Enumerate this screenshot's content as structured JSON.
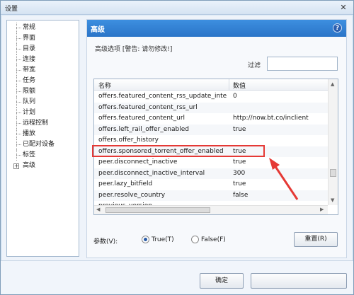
{
  "window": {
    "title": "设置",
    "close_glyph": "✕"
  },
  "nav": {
    "items": [
      {
        "label": "常规"
      },
      {
        "label": "界面"
      },
      {
        "label": "目录"
      },
      {
        "label": "连接"
      },
      {
        "label": "带宽"
      },
      {
        "label": "任务"
      },
      {
        "label": "限额"
      },
      {
        "label": "队列"
      },
      {
        "label": "计划"
      },
      {
        "label": "远程控制"
      },
      {
        "label": "播放"
      },
      {
        "label": "已配对设备"
      },
      {
        "label": "标签"
      },
      {
        "label": "高级",
        "expander": "+"
      }
    ]
  },
  "panel": {
    "title": "高级",
    "help_glyph": "?",
    "section_label": "高级选项 [警告: 请勿修改!]",
    "filter_label": "过滤",
    "filter_value": "",
    "columns": {
      "name": "名称",
      "value": "数值"
    },
    "rows": [
      {
        "name": "offers.featured_content_rss_update_interv...",
        "value": "0"
      },
      {
        "name": "offers.featured_content_rss_url",
        "value": ""
      },
      {
        "name": "offers.featured_content_url",
        "value": "http://now.bt.co/inclient"
      },
      {
        "name": "offers.left_rail_offer_enabled",
        "value": "true"
      },
      {
        "name": "offers.offer_history",
        "value": ""
      },
      {
        "name": "offers.sponsored_torrent_offer_enabled",
        "value": "true"
      },
      {
        "name": "peer.disconnect_inactive",
        "value": "true"
      },
      {
        "name": "peer.disconnect_inactive_interval",
        "value": "300"
      },
      {
        "name": "peer.lazy_bitfield",
        "value": "true"
      },
      {
        "name": "peer.resolve_country",
        "value": "false"
      },
      {
        "name": "previous_version",
        "value": ""
      }
    ],
    "param_label": "参数(V):",
    "radio_true": "True(T)",
    "radio_false": "False(F)",
    "selected": "True(T)",
    "reset_label": "重置(R)"
  },
  "footer": {
    "ok_label": "确定",
    "second_label": ""
  },
  "colors": {
    "accent": "#2a74c8",
    "highlight": "#e53935"
  }
}
